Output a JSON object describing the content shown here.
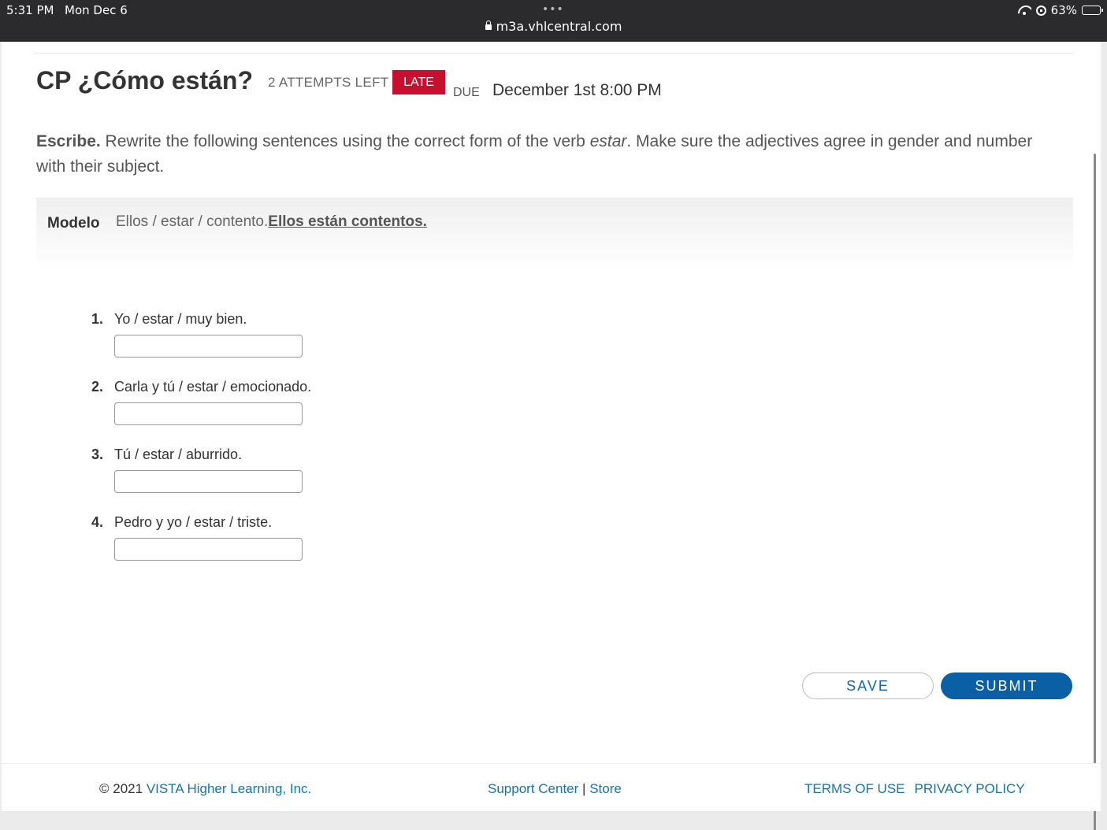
{
  "status_bar": {
    "time": "5:31 PM",
    "date": "Mon Dec 6",
    "dots": "•••",
    "url": "m3a.vhlcentral.com",
    "battery": "63%",
    "battery_level": 0.63
  },
  "header": {
    "title": "CP ¿Cómo están?",
    "attempts": "2 ATTEMPTS LEFT",
    "late_badge": "LATE",
    "due_label": "DUE",
    "due_date": "December 1st 8:00 PM"
  },
  "instructions": {
    "lead": "Escribe.",
    "text_before": " Rewrite the following sentences using the correct form of the verb ",
    "verb": "estar",
    "text_after": ". Make sure the adjectives agree in gender and number with their subject."
  },
  "modelo": {
    "label": "Modelo",
    "prompt": "Ellos / estar / contento.",
    "answer": "Ellos están contentos."
  },
  "items": [
    {
      "num": "1.",
      "text": "Yo / estar / muy bien.",
      "value": ""
    },
    {
      "num": "2.",
      "text": "Carla y tú / estar / emocionado.",
      "value": ""
    },
    {
      "num": "3.",
      "text": "Tú / estar / aburrido.",
      "value": ""
    },
    {
      "num": "4.",
      "text": "Pedro y yo / estar / triste.",
      "value": ""
    }
  ],
  "buttons": {
    "save": "SAVE",
    "submit": "SUBMIT"
  },
  "footer": {
    "copyright": "© 2021",
    "company": "VISTA Higher Learning, Inc.",
    "support": "Support Center",
    "separator": "|",
    "store": "Store",
    "terms": "TERMS OF USE",
    "privacy": "PRIVACY POLICY"
  },
  "colors": {
    "late": "#c8102e",
    "primary": "#0b5fa5",
    "link": "#1a73a8"
  }
}
